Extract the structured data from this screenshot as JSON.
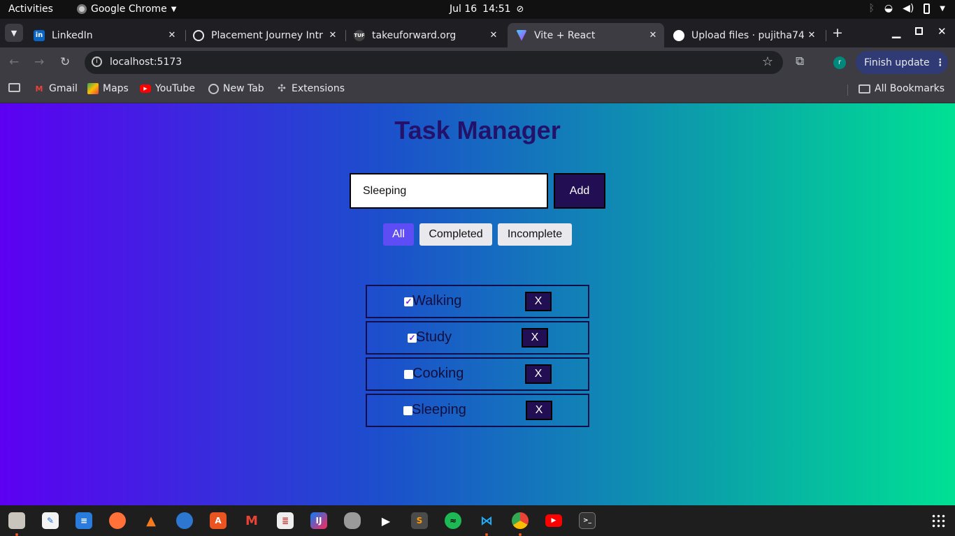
{
  "topbar": {
    "activities": "Activities",
    "app_name": "Google Chrome",
    "date": "Jul 16",
    "time": "14:51"
  },
  "tabs": [
    {
      "title": "LinkedIn",
      "favicon": "in",
      "color": "#0a66c2"
    },
    {
      "title": "Placement Journey Intr",
      "favicon": "",
      "color": "#e8eaed"
    },
    {
      "title": "takeuforward.org",
      "favicon": "T",
      "color": "#333333"
    },
    {
      "title": "Vite + React",
      "favicon": "V",
      "color": "#a855f7",
      "active": true
    },
    {
      "title": "Upload files · pujitha74",
      "favicon": "",
      "color": "#ffffff"
    }
  ],
  "toolbar": {
    "url": "localhost:5173",
    "profile_initial": "r",
    "finish_update": "Finish update"
  },
  "bookmarks": [
    {
      "label": "Gmail"
    },
    {
      "label": "Maps"
    },
    {
      "label": "YouTube"
    },
    {
      "label": "New Tab"
    },
    {
      "label": "Extensions"
    }
  ],
  "all_bookmarks": "All Bookmarks",
  "app": {
    "title": "Task Manager",
    "input_value": "Sleeping",
    "add_label": "Add",
    "filters": [
      {
        "label": "All",
        "active": true
      },
      {
        "label": "Completed",
        "active": false
      },
      {
        "label": "Incomplete",
        "active": false
      }
    ],
    "tasks": [
      {
        "label": "Walking",
        "done": true,
        "delete_label": "X"
      },
      {
        "label": "Study",
        "done": true,
        "delete_label": "X"
      },
      {
        "label": "Cooking",
        "done": false,
        "delete_label": "X"
      },
      {
        "label": "Sleeping",
        "done": false,
        "delete_label": "X"
      }
    ]
  },
  "colors": {
    "gradient_start": "#5c00f2",
    "gradient_end": "#00e094",
    "title": "#23116a",
    "button": "#220e52",
    "filter_active": "#5e4cf5"
  },
  "dock_apps": [
    "files-icon",
    "text-editor-icon",
    "docs-icon",
    "firefox-icon",
    "vlc-icon",
    "thunderbird-icon",
    "app-center-icon",
    "gmail-icon",
    "writer-icon",
    "intellij-icon",
    "database-icon",
    "terminal-app-icon",
    "sublime-icon",
    "spotify-icon",
    "vscode-icon",
    "chrome-icon",
    "youtube-icon",
    "terminal-icon"
  ]
}
